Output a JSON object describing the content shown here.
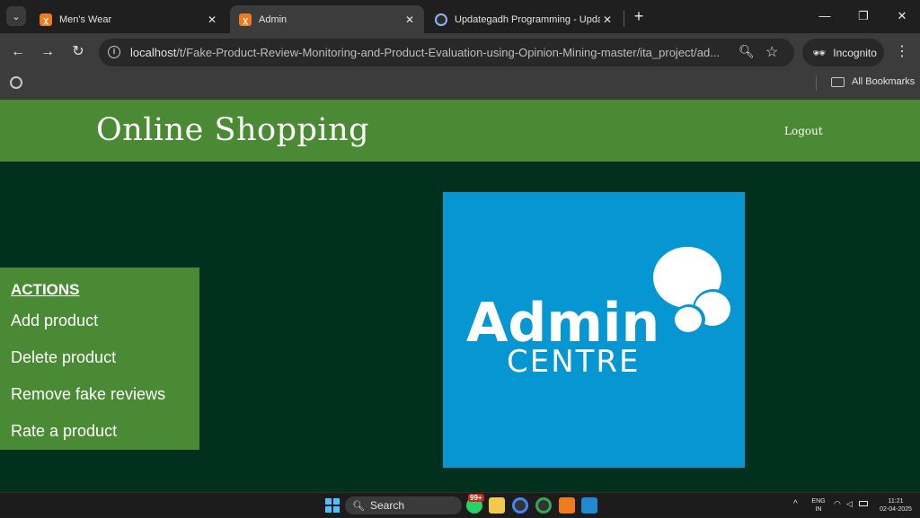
{
  "browser": {
    "tabs": [
      {
        "title": "Men's Wear",
        "favicon": "xampp-icon",
        "active": false
      },
      {
        "title": "Admin",
        "favicon": "xampp-icon",
        "active": true
      },
      {
        "title": "Updategadh Programming - Upda",
        "favicon": "updategadh-icon",
        "active": false
      }
    ],
    "url_host": "localhost",
    "url_path": "/t/Fake-Product-Review-Monitoring-and-Product-Evaluation-using-Opinion-Mining-master/ita_project/ad...",
    "incognito_label": "Incognito",
    "bookmarks_label": "All Bookmarks"
  },
  "site": {
    "title": "Online Shopping",
    "logout_label": "Logout",
    "actions_heading": "ACTIONS",
    "actions": [
      {
        "label": "Add product"
      },
      {
        "label": "Delete product"
      },
      {
        "label": "Remove fake reviews"
      },
      {
        "label": "Rate a product"
      }
    ],
    "logo": {
      "line1": "Admin",
      "line2": "CENTRE",
      "background": "#0696d1"
    },
    "colors": {
      "header": "#4b8a35",
      "page_bg": "#02301e"
    }
  },
  "taskbar": {
    "search_label": "Search",
    "whatsapp_badge": "99+",
    "lang_1": "ENG",
    "lang_2": "IN",
    "time": "11:21",
    "date": "02-04-2025"
  }
}
